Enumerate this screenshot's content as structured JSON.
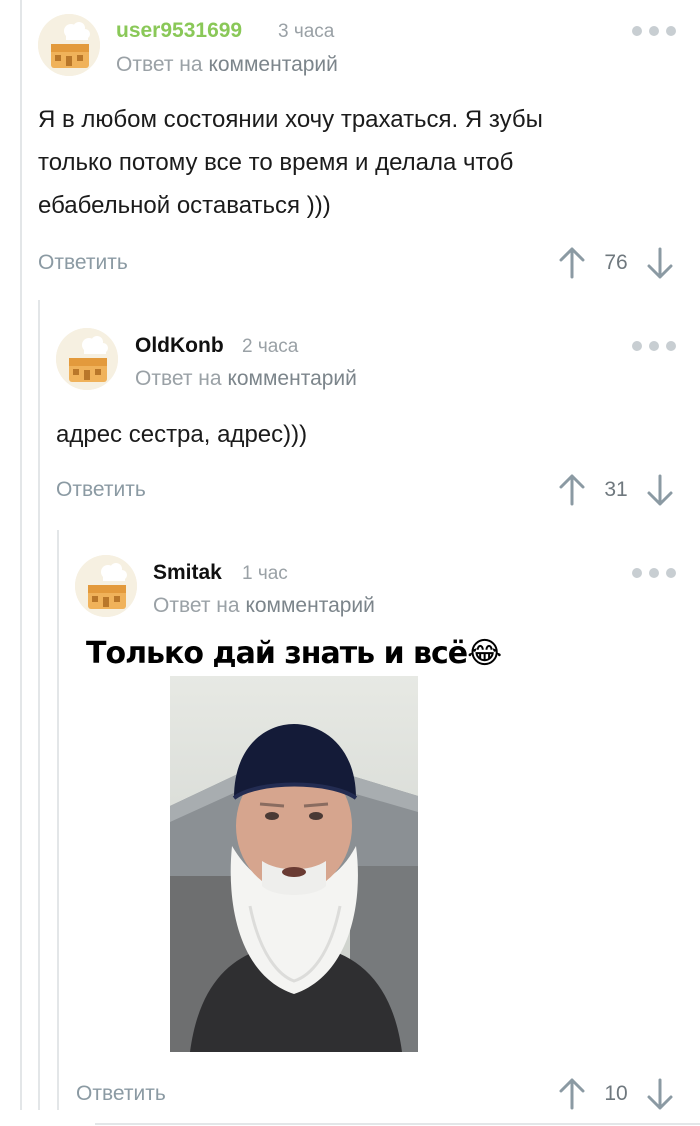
{
  "comments": [
    {
      "username": "user9531699",
      "username_color": "#8ac858",
      "time": "3 часа",
      "reply_prefix": "Ответ на",
      "reply_link": "комментарий",
      "text_lines": [
        "Я в любом состоянии хочу трахаться. Я зубы",
        "только потому все то время и делала чтоб",
        "ебабельной оставаться )))"
      ],
      "reply_label": "Ответить",
      "score": "76"
    },
    {
      "username": "OldKonb",
      "username_color": "#111111",
      "time": "2 часа",
      "reply_prefix": "Ответ на",
      "reply_link": "комментарий",
      "text_lines": [
        "адрес сестра, адрес)))"
      ],
      "reply_label": "Ответить",
      "score": "31"
    },
    {
      "username": "Smitak",
      "username_color": "#111111",
      "time": "1 час",
      "reply_prefix": "Ответ на",
      "reply_link": "комментарий",
      "meme_caption": "Только дай знать и всё😂",
      "reply_label": "Ответить",
      "score": "10"
    }
  ],
  "icons": {
    "avatar": "default-avatar-icon",
    "more": "more-dots-icon",
    "vote_up": "arrow-up-icon",
    "vote_down": "arrow-down-icon"
  },
  "colors": {
    "accent_green": "#8ac858",
    "muted_text": "#9aa1a6",
    "reply_button": "#8b9aa3",
    "thread_line": "#e3e6e8"
  }
}
